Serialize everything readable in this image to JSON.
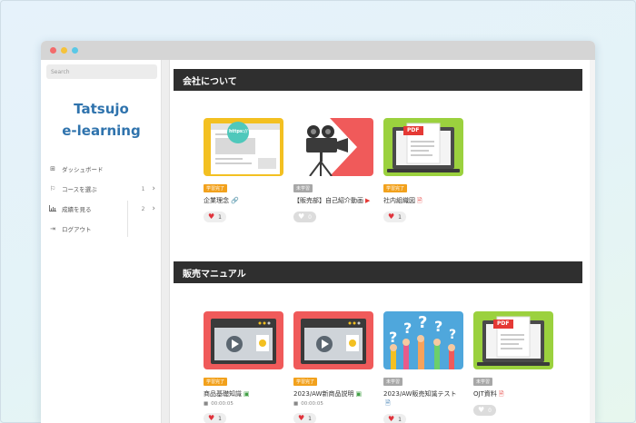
{
  "colors": {
    "brand": "#2f73ad",
    "header_bg": "#2f2f2f",
    "badge_done": "#f2a11c",
    "badge_todo": "#a7a7a7",
    "heart": "#e0333c"
  },
  "sidebar": {
    "search_placeholder": "Search",
    "brand_line1": "Tatsujo",
    "brand_line2": "e-learning",
    "items": [
      {
        "icon": "dashboard-icon",
        "label": "ダッシュボード",
        "count": ""
      },
      {
        "icon": "flag-icon",
        "label": "コースを選ぶ",
        "count": "1"
      },
      {
        "icon": "chart-icon",
        "label": "成績を見る",
        "count": "2"
      },
      {
        "icon": "logout-icon",
        "label": "ログアウト",
        "count": ""
      }
    ]
  },
  "sections": [
    {
      "title": "会社について",
      "cards": [
        {
          "badge": "学習完了",
          "title": "企業理念",
          "likes": "1",
          "suffix_icon": "link-icon"
        },
        {
          "badge": "未学習",
          "title": "【販売部】自己紹介動画",
          "likes": "0",
          "suffix_icon": "youtube-icon"
        },
        {
          "badge": "学習完了",
          "title": "社内組織図",
          "likes": "1",
          "suffix_icon": "pdf-icon"
        }
      ]
    },
    {
      "title": "販売マニュアル",
      "cards": [
        {
          "badge": "学習完了",
          "title": "商品基礎知識",
          "duration": "00:00:05",
          "likes": "1",
          "suffix_icon": "slides-icon"
        },
        {
          "badge": "学習完了",
          "title": "2023/AW新商品説明",
          "duration": "00:00:05",
          "likes": "1",
          "suffix_icon": "slides-icon"
        },
        {
          "badge": "未学習",
          "title": "2023/AW販売知識テスト",
          "likes": "1",
          "suffix_icon": "doc-icon"
        },
        {
          "badge": "未学習",
          "title": "OJT資料",
          "likes": "0",
          "suffix_icon": "pdf-icon"
        }
      ]
    }
  ],
  "thumbs": {
    "pdf_label": "PDF",
    "url_label": "https://"
  }
}
